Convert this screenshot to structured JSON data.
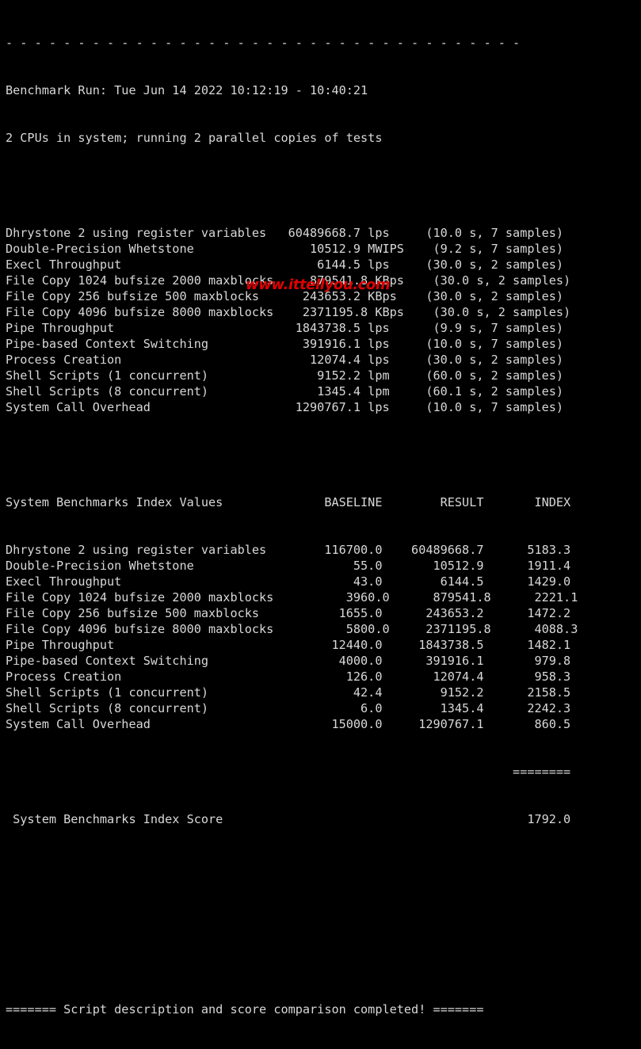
{
  "terminal": {
    "background_color": "#000000",
    "text_color": "#d8d8d8",
    "columns": 78
  },
  "watermark": {
    "text": "www.ittellyou.com",
    "color": "#e00000"
  },
  "separator_top": "- - - - - - - - - - - - - - - - - - - - - - - - - - - - - - - - - - - -",
  "header": {
    "run_line": "Benchmark Run: Tue Jun 14 2022 10:12:19 - 10:40:21",
    "cpu_line": "2 CPUs in system; running 2 parallel copies of tests"
  },
  "raw_results": [
    {
      "name": "Dhrystone 2 using register variables",
      "value": "60489668.7",
      "unit": "lps",
      "samples": "(10.0 s, 7 samples)"
    },
    {
      "name": "Double-Precision Whetstone",
      "value": "10512.9",
      "unit": "MWIPS",
      "samples": "(9.2 s, 7 samples)"
    },
    {
      "name": "Execl Throughput",
      "value": "6144.5",
      "unit": "lps",
      "samples": "(30.0 s, 2 samples)"
    },
    {
      "name": "File Copy 1024 bufsize 2000 maxblocks",
      "value": "879541.8",
      "unit": "KBps",
      "samples": "(30.0 s, 2 samples)"
    },
    {
      "name": "File Copy 256 bufsize 500 maxblocks",
      "value": "243653.2",
      "unit": "KBps",
      "samples": "(30.0 s, 2 samples)"
    },
    {
      "name": "File Copy 4096 bufsize 8000 maxblocks",
      "value": "2371195.8",
      "unit": "KBps",
      "samples": "(30.0 s, 2 samples)"
    },
    {
      "name": "Pipe Throughput",
      "value": "1843738.5",
      "unit": "lps",
      "samples": "(9.9 s, 7 samples)"
    },
    {
      "name": "Pipe-based Context Switching",
      "value": "391916.1",
      "unit": "lps",
      "samples": "(10.0 s, 7 samples)"
    },
    {
      "name": "Process Creation",
      "value": "12074.4",
      "unit": "lps",
      "samples": "(30.0 s, 2 samples)"
    },
    {
      "name": "Shell Scripts (1 concurrent)",
      "value": "9152.2",
      "unit": "lpm",
      "samples": "(60.0 s, 2 samples)"
    },
    {
      "name": "Shell Scripts (8 concurrent)",
      "value": "1345.4",
      "unit": "lpm",
      "samples": "(60.1 s, 2 samples)"
    },
    {
      "name": "System Call Overhead",
      "value": "1290767.1",
      "unit": "lps",
      "samples": "(10.0 s, 7 samples)"
    }
  ],
  "index_table": {
    "title": "System Benchmarks Index Values",
    "columns": [
      "BASELINE",
      "RESULT",
      "INDEX"
    ],
    "rows": [
      {
        "name": "Dhrystone 2 using register variables",
        "baseline": "116700.0",
        "result": "60489668.7",
        "index": "5183.3"
      },
      {
        "name": "Double-Precision Whetstone",
        "baseline": "55.0",
        "result": "10512.9",
        "index": "1911.4"
      },
      {
        "name": "Execl Throughput",
        "baseline": "43.0",
        "result": "6144.5",
        "index": "1429.0"
      },
      {
        "name": "File Copy 1024 bufsize 2000 maxblocks",
        "baseline": "3960.0",
        "result": "879541.8",
        "index": "2221.1"
      },
      {
        "name": "File Copy 256 bufsize 500 maxblocks",
        "baseline": "1655.0",
        "result": "243653.2",
        "index": "1472.2"
      },
      {
        "name": "File Copy 4096 bufsize 8000 maxblocks",
        "baseline": "5800.0",
        "result": "2371195.8",
        "index": "4088.3"
      },
      {
        "name": "Pipe Throughput",
        "baseline": "12440.0",
        "result": "1843738.5",
        "index": "1482.1"
      },
      {
        "name": "Pipe-based Context Switching",
        "baseline": "4000.0",
        "result": "391916.1",
        "index": "979.8"
      },
      {
        "name": "Process Creation",
        "baseline": "126.0",
        "result": "12074.4",
        "index": "958.3"
      },
      {
        "name": "Shell Scripts (1 concurrent)",
        "baseline": "42.4",
        "result": "9152.2",
        "index": "2158.5"
      },
      {
        "name": "Shell Scripts (8 concurrent)",
        "baseline": "6.0",
        "result": "1345.4",
        "index": "2242.3"
      },
      {
        "name": "System Call Overhead",
        "baseline": "15000.0",
        "result": "1290767.1",
        "index": "860.5"
      }
    ],
    "score_rule": "========",
    "score_label": "System Benchmarks Index Score",
    "score_value": "1792.0"
  },
  "footer": {
    "text": "======= Script description and score comparison completed! ======="
  }
}
